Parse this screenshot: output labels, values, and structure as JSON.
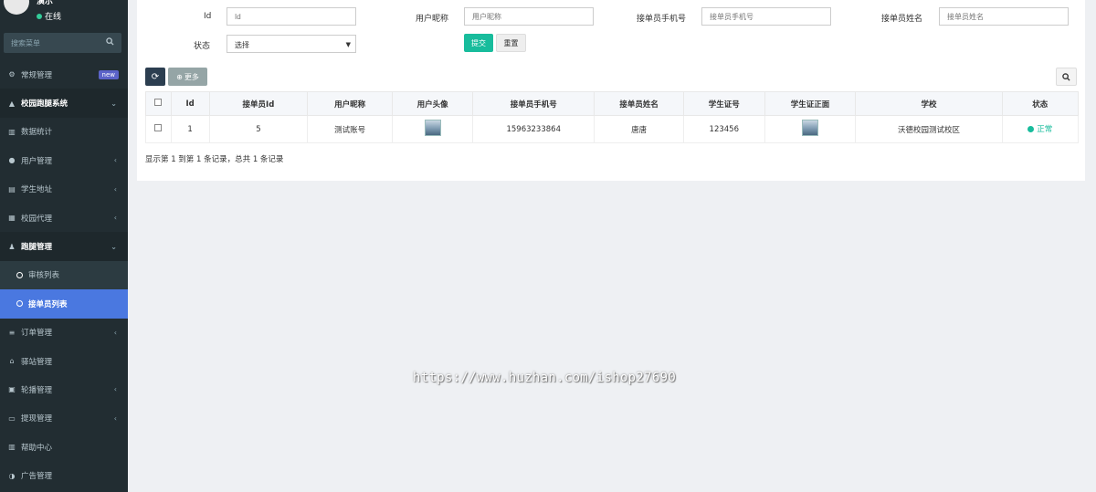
{
  "user": {
    "name": "演示",
    "status": "在线"
  },
  "sidebar": {
    "search_placeholder": "搜索菜单",
    "items": [
      {
        "label": "常规管理",
        "icon": "gears-icon",
        "badge": "new"
      },
      {
        "label": "校园跑腿系统",
        "icon": "graduation-cap-icon"
      },
      {
        "label": "数据统计",
        "icon": "bar-chart-icon"
      },
      {
        "label": "用户管理",
        "icon": "user-circle-icon"
      },
      {
        "label": "学生地址",
        "icon": "id-card-icon"
      },
      {
        "label": "校园代理",
        "icon": "list-box-icon"
      },
      {
        "label": "跑腿管理",
        "icon": "user-icon"
      },
      {
        "label": "审核列表",
        "icon": "circle-icon"
      },
      {
        "label": "接单员列表",
        "icon": "circle-icon"
      },
      {
        "label": "订单管理",
        "icon": "list-icon"
      },
      {
        "label": "驿站管理",
        "icon": "home-icon"
      },
      {
        "label": "轮播管理",
        "icon": "image-icon"
      },
      {
        "label": "提现管理",
        "icon": "card-icon"
      },
      {
        "label": "帮助中心",
        "icon": "bar-chart-icon"
      },
      {
        "label": "广告管理",
        "icon": "half-circle-icon"
      }
    ]
  },
  "filters": {
    "id_label": "Id",
    "id_placeholder": "Id",
    "nickname_label": "用户昵称",
    "nickname_placeholder": "用户昵称",
    "phone_label": "接单员手机号",
    "phone_placeholder": "接单员手机号",
    "name_label": "接单员姓名",
    "name_placeholder": "接单员姓名",
    "status_label": "状态",
    "status_value": "选择",
    "submit": "提交",
    "reset": "重置"
  },
  "toolbar": {
    "more": "更多"
  },
  "table": {
    "headers": [
      "Id",
      "接单员Id",
      "用户昵称",
      "用户头像",
      "接单员手机号",
      "接单员姓名",
      "学生证号",
      "学生证正面",
      "学校",
      "状态"
    ],
    "rows": [
      {
        "id": "1",
        "rider_id": "5",
        "nickname": "测试账号",
        "phone": "15963233864",
        "name": "唐唐",
        "student_no": "123456",
        "school": "沃德校园测试校区",
        "status": "正常"
      }
    ]
  },
  "pagination": "显示第 1 到第 1 条记录，总共 1 条记录",
  "watermark": "https://www.huzhan.com/ishop27690",
  "colors": {
    "sidebar": "#222d32",
    "active": "#4a78e0",
    "success": "#18bc9c",
    "badge": "#5b63c8"
  }
}
